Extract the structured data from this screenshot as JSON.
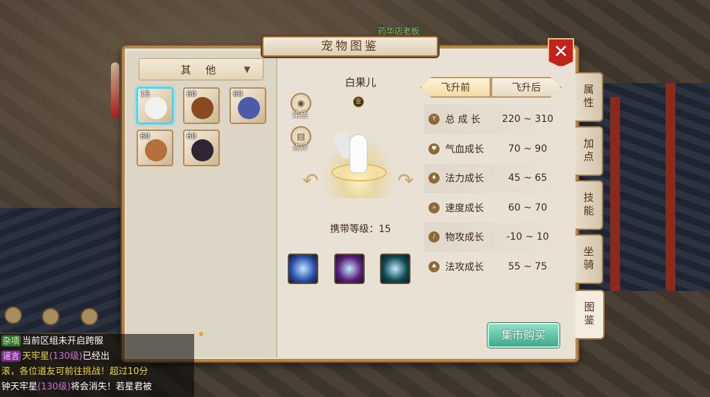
{
  "background": {
    "sign_text": "药华店老板"
  },
  "window": {
    "title": "宠物图鉴",
    "close_label": "✕"
  },
  "filter": {
    "selected": "其 他",
    "arrow": "▼"
  },
  "pets": [
    {
      "level": "15",
      "color": "#f3f1ee",
      "selected": true
    },
    {
      "level": "60",
      "color": "#8a4a1f",
      "selected": false
    },
    {
      "level": "60",
      "color": "#4d5aa8",
      "selected": false
    },
    {
      "level": "60",
      "color": "#b5703e",
      "selected": false
    },
    {
      "level": "60",
      "color": "#2e2634",
      "selected": false
    }
  ],
  "detail": {
    "name": "白果儿",
    "grade": "金",
    "dye_label": "染色",
    "review_label": "点评",
    "carry_level": "携带等级：15",
    "skills": [
      {
        "icon": "feather-skill-icon",
        "color": "#2b4fae"
      },
      {
        "icon": "claw-skill-icon",
        "color": "#5a1f7a"
      },
      {
        "icon": "ring-skill-icon",
        "color": "#0f4b52"
      }
    ]
  },
  "stage_tabs": {
    "before": "飞升前",
    "after": "飞升后",
    "active": "before"
  },
  "stats": [
    {
      "icon": "Y",
      "label": "总 成 长",
      "value": "220 ~ 310"
    },
    {
      "icon": "♥",
      "label": "气血成长",
      "value": "70 ~ 90"
    },
    {
      "icon": "♦",
      "label": "法力成长",
      "value": "45 ~ 65"
    },
    {
      "icon": "»",
      "label": "速度成长",
      "value": "60 ~ 70"
    },
    {
      "icon": "/",
      "label": "物攻成长",
      "value": "-10 ~ 10"
    },
    {
      "icon": "♠",
      "label": "法攻成长",
      "value": "55 ~ 75"
    }
  ],
  "buy_button": "集市购买",
  "side_tabs": [
    {
      "label": "属性",
      "active": false
    },
    {
      "label": "加点",
      "active": false
    },
    {
      "label": "技能",
      "active": false
    },
    {
      "label": "坐骑",
      "active": false
    },
    {
      "label": "图鉴",
      "active": true
    }
  ],
  "chat": [
    {
      "tag": "杂项",
      "tag_type": "misc",
      "star": "",
      "lvl": "",
      "text": "当前区组未开启跨服"
    },
    {
      "tag": "谣言",
      "tag_type": "rumor",
      "star": "天牢星",
      "lvl": "(130级)",
      "text": "已经出"
    },
    {
      "tag": "",
      "tag_type": "",
      "star": "",
      "lvl": "",
      "text": "滚，各位道友可前往挑战！超过10分"
    },
    {
      "tag": "",
      "tag_type": "",
      "star": "钟天牢星",
      "lvl": "(130级)",
      "text": "将会消失！若星君被"
    }
  ]
}
